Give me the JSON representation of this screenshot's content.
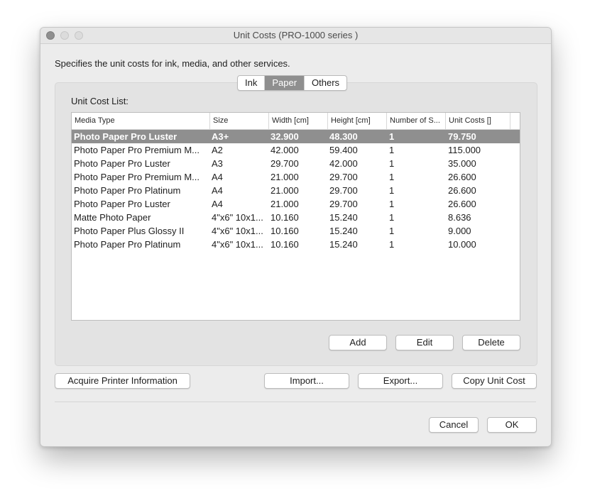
{
  "window": {
    "title": "Unit Costs (PRO-1000 series )"
  },
  "description": "Specifies the unit costs for ink, media, and other services.",
  "tabs": [
    {
      "label": "Ink",
      "active": false
    },
    {
      "label": "Paper",
      "active": true
    },
    {
      "label": "Others",
      "active": false
    }
  ],
  "list": {
    "label": "Unit Cost List:",
    "columns": [
      "Media Type",
      "Size",
      "Width [cm]",
      "Height [cm]",
      "Number of S...",
      "Unit Costs []"
    ],
    "rows": [
      [
        "Photo Paper Pro Luster",
        "A3+",
        "32.900",
        "48.300",
        "1",
        "79.750"
      ],
      [
        "Photo Paper Pro Premium M...",
        "A2",
        "42.000",
        "59.400",
        "1",
        "115.000"
      ],
      [
        "Photo Paper Pro Luster",
        "A3",
        "29.700",
        "42.000",
        "1",
        "35.000"
      ],
      [
        "Photo Paper Pro Premium M...",
        "A4",
        "21.000",
        "29.700",
        "1",
        "26.600"
      ],
      [
        "Photo Paper Pro Platinum",
        "A4",
        "21.000",
        "29.700",
        "1",
        "26.600"
      ],
      [
        "Photo Paper Pro Luster",
        "A4",
        "21.000",
        "29.700",
        "1",
        "26.600"
      ],
      [
        "Matte Photo Paper",
        "4\"x6\" 10x1...",
        "10.160",
        "15.240",
        "1",
        "8.636"
      ],
      [
        "Photo Paper Plus Glossy II",
        "4\"x6\" 10x1...",
        "10.160",
        "15.240",
        "1",
        "9.000"
      ],
      [
        "Photo Paper Pro Platinum",
        "4\"x6\" 10x1...",
        "10.160",
        "15.240",
        "1",
        "10.000"
      ]
    ],
    "selected_row": 0
  },
  "buttons": {
    "add": "Add",
    "edit": "Edit",
    "delete": "Delete",
    "acquire": "Acquire Printer Information",
    "import": "Import...",
    "export": "Export...",
    "copy_unit_cost": "Copy Unit Cost",
    "cancel": "Cancel",
    "ok": "OK"
  },
  "colors": {
    "selection": "#8f8f8f",
    "window_bg": "#ececec"
  }
}
